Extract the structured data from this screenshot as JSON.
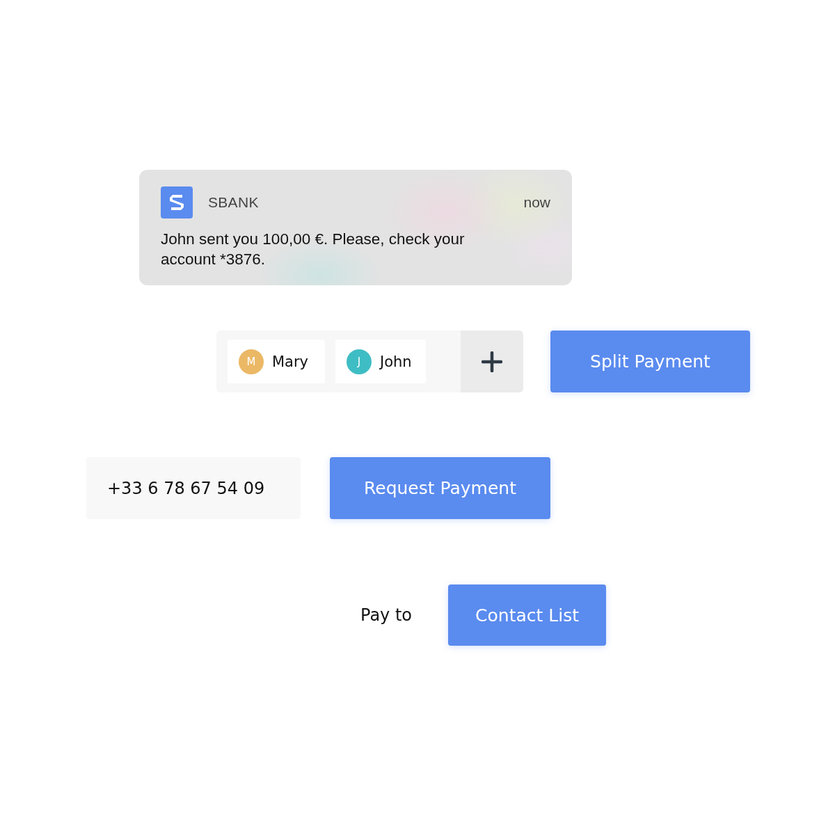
{
  "notification": {
    "app_name": "SBANK",
    "time": "now",
    "message": "John sent you 100,00 €. Please, check your account *3876."
  },
  "split": {
    "contacts": [
      {
        "initial": "M",
        "name": "Mary",
        "color": "#ebb865"
      },
      {
        "initial": "J",
        "name": "John",
        "color": "#3fbdc4"
      }
    ],
    "button": "Split Payment"
  },
  "request": {
    "phone": "+33 6 78 67 54 09",
    "button": "Request Payment"
  },
  "pay": {
    "label": "Pay to",
    "button": "Contact List"
  }
}
